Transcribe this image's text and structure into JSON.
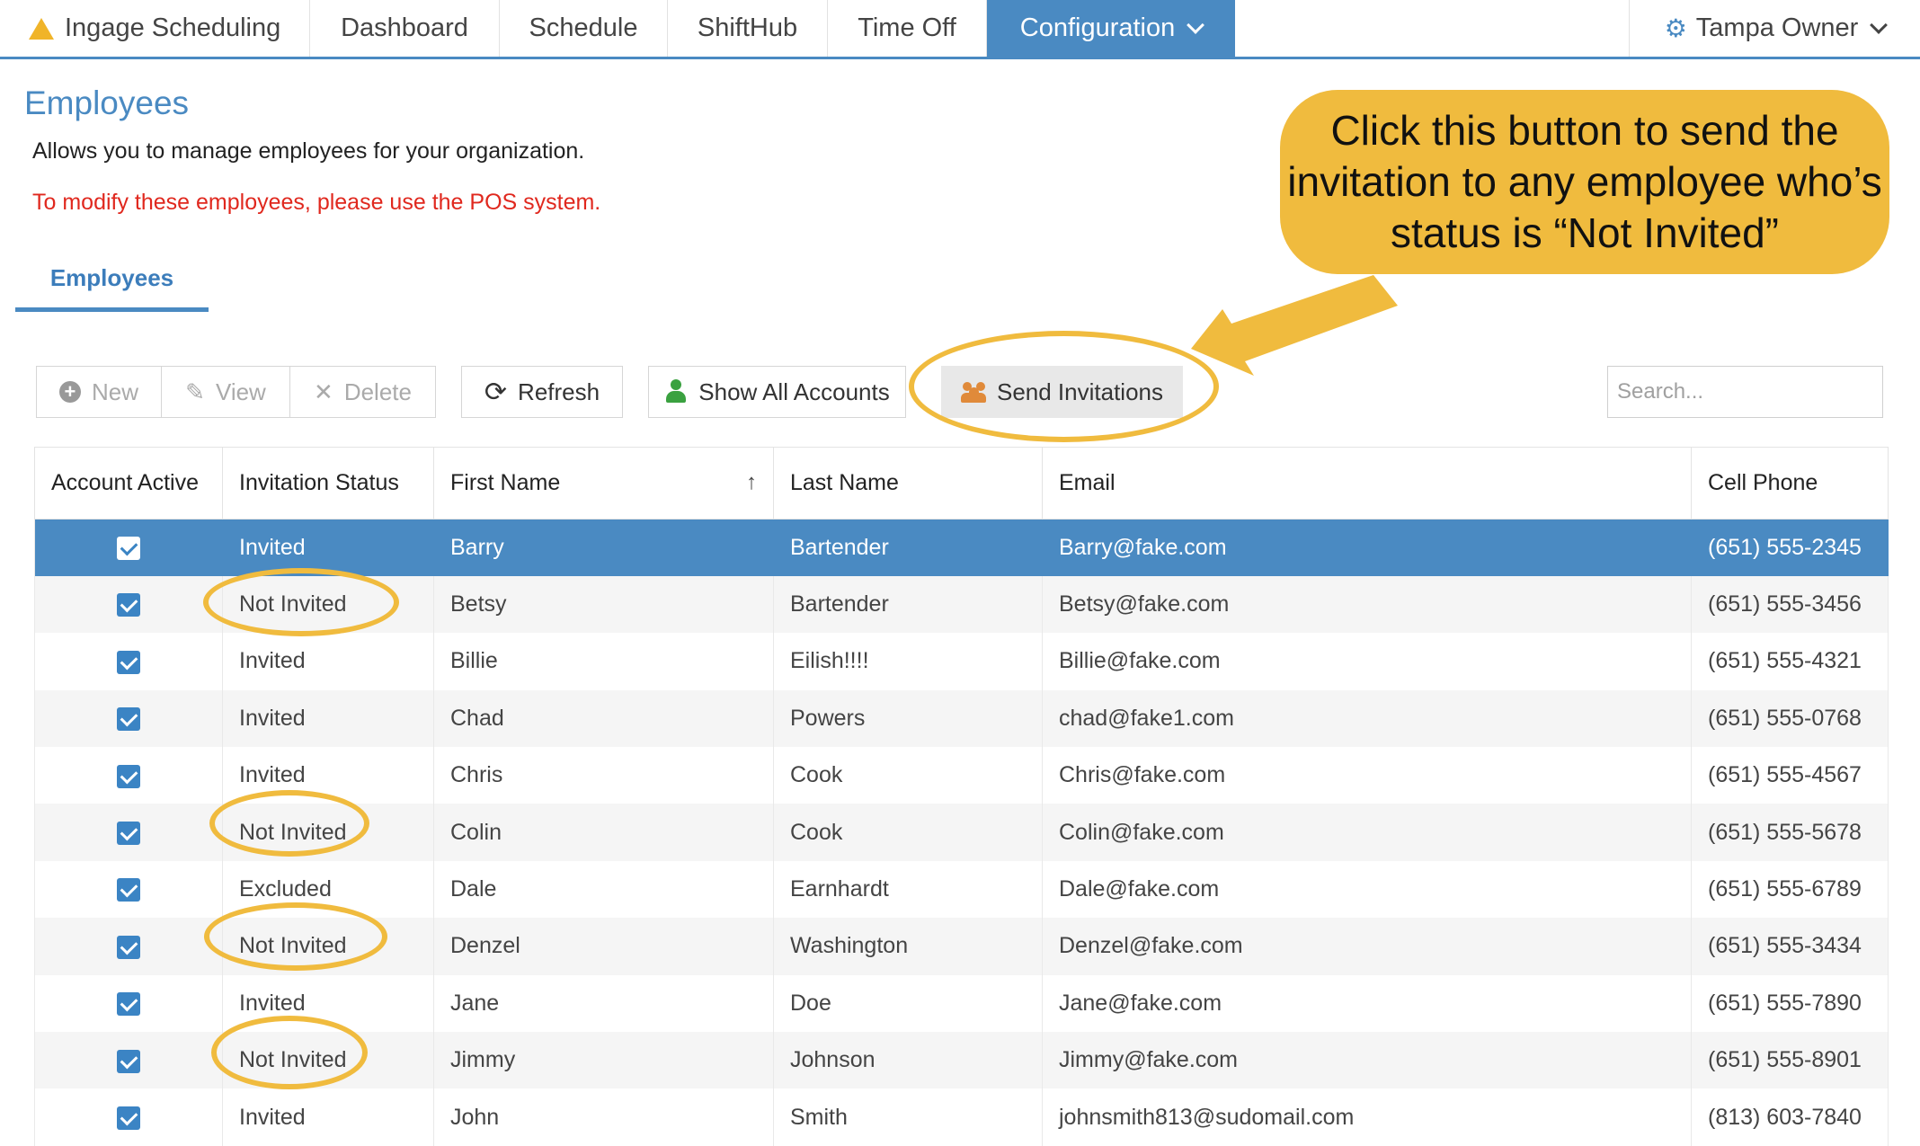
{
  "nav": {
    "brand": "Ingage Scheduling",
    "items": [
      "Dashboard",
      "Schedule",
      "ShiftHub",
      "Time Off",
      "Configuration"
    ],
    "active": "Configuration",
    "user": "Tampa Owner"
  },
  "page": {
    "title": "Employees",
    "description": "Allows you to manage employees for your organization.",
    "warning": "To modify these employees, please use the POS system.",
    "tab": "Employees"
  },
  "toolbar": {
    "new": "New",
    "view": "View",
    "delete": "Delete",
    "refresh": "Refresh",
    "show_all": "Show All Accounts",
    "send_invitations": "Send Invitations",
    "search_placeholder": "Search..."
  },
  "table": {
    "columns": [
      "Account Active",
      "Invitation Status",
      "First Name",
      "Last Name",
      "Email",
      "Cell Phone"
    ],
    "rows": [
      {
        "active": true,
        "status": "Invited",
        "first": "Barry",
        "last": "Bartender",
        "email": "Barry@fake.com",
        "phone": "(651) 555-2345"
      },
      {
        "active": true,
        "status": "Not Invited",
        "first": "Betsy",
        "last": "Bartender",
        "email": "Betsy@fake.com",
        "phone": "(651) 555-3456"
      },
      {
        "active": true,
        "status": "Invited",
        "first": "Billie",
        "last": "Eilish!!!!",
        "email": "Billie@fake.com",
        "phone": "(651) 555-4321"
      },
      {
        "active": true,
        "status": "Invited",
        "first": "Chad",
        "last": "Powers",
        "email": "chad@fake1.com",
        "phone": "(651) 555-0768"
      },
      {
        "active": true,
        "status": "Invited",
        "first": "Chris",
        "last": "Cook",
        "email": "Chris@fake.com",
        "phone": "(651) 555-4567"
      },
      {
        "active": true,
        "status": "Not Invited",
        "first": "Colin",
        "last": "Cook",
        "email": "Colin@fake.com",
        "phone": "(651) 555-5678"
      },
      {
        "active": true,
        "status": "Excluded",
        "first": "Dale",
        "last": "Earnhardt",
        "email": "Dale@fake.com",
        "phone": "(651) 555-6789"
      },
      {
        "active": true,
        "status": "Not Invited",
        "first": "Denzel",
        "last": "Washington",
        "email": "Denzel@fake.com",
        "phone": "(651) 555-3434"
      },
      {
        "active": true,
        "status": "Invited",
        "first": "Jane",
        "last": "Doe",
        "email": "Jane@fake.com",
        "phone": "(651) 555-7890"
      },
      {
        "active": true,
        "status": "Not Invited",
        "first": "Jimmy",
        "last": "Johnson",
        "email": "Jimmy@fake.com",
        "phone": "(651) 555-8901"
      },
      {
        "active": true,
        "status": "Invited",
        "first": "John",
        "last": "Smith",
        "email": "johnsmith813@sudomail.com",
        "phone": "(813) 603-7840"
      }
    ],
    "selected_row": 0
  },
  "annotation": {
    "callout": "Click this button to send the invitation to any employee who’s status is “Not Invited”"
  },
  "colors": {
    "accent": "#4a8ac2",
    "warning": "#e0281e",
    "highlight": "#f0bb3e"
  }
}
